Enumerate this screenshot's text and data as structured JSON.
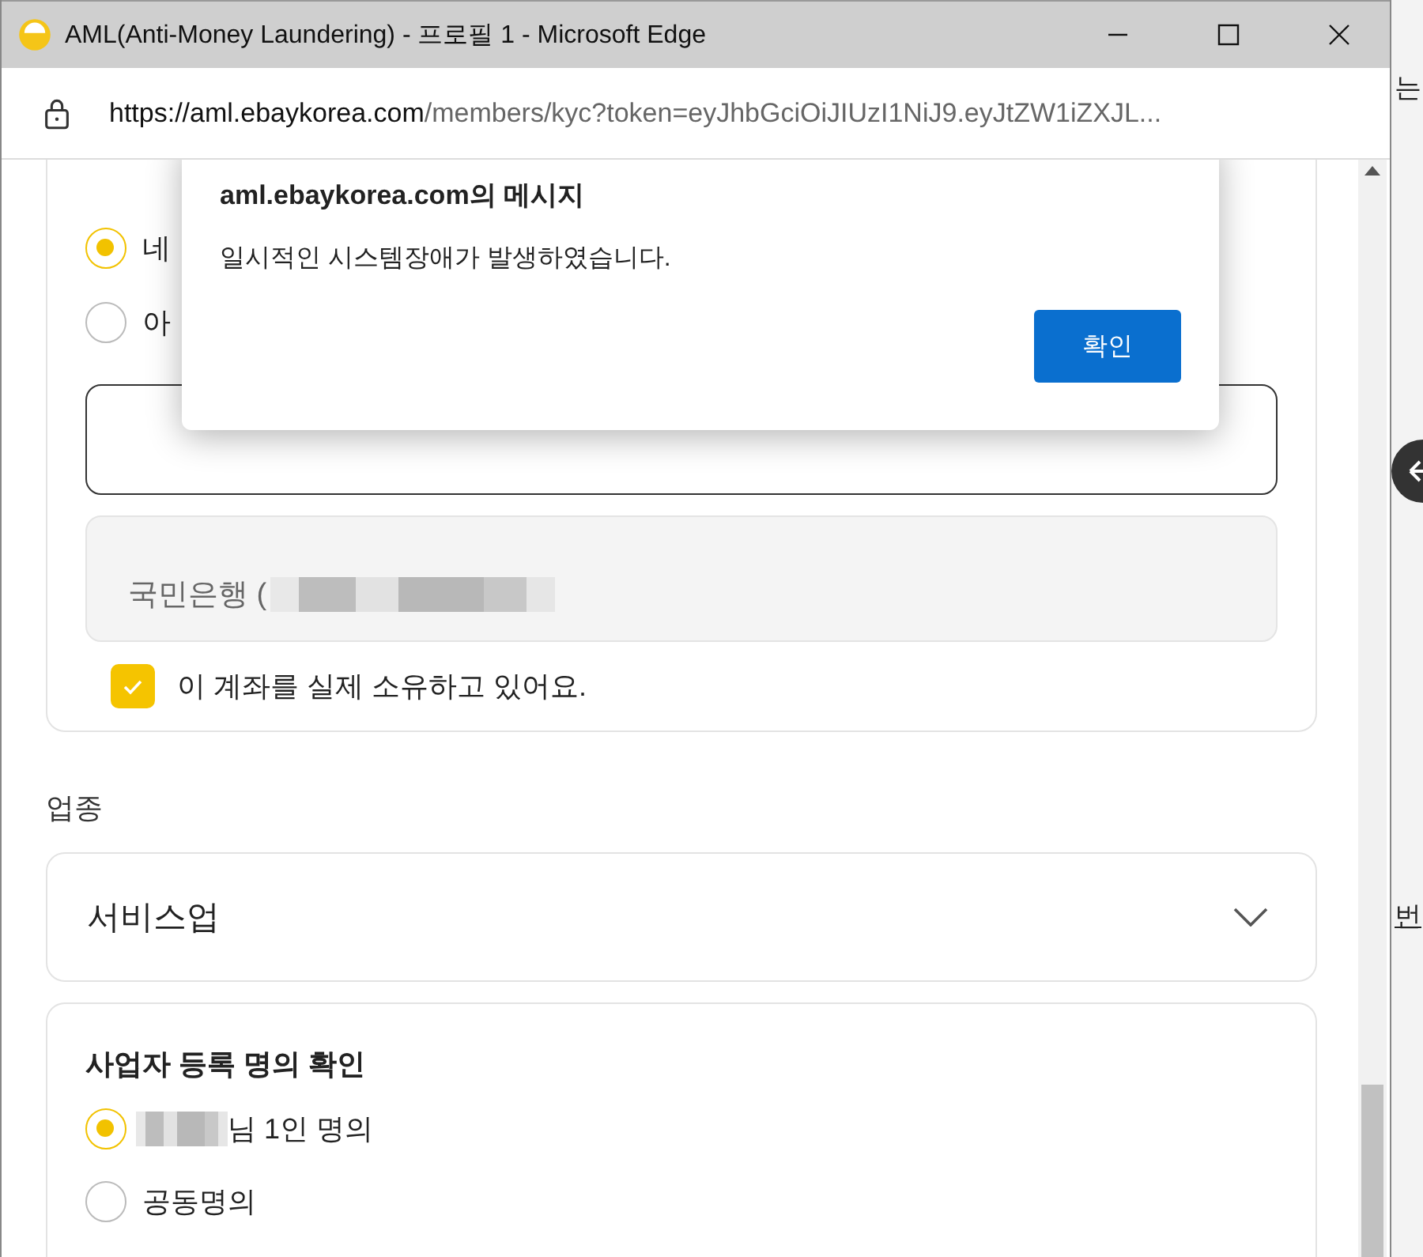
{
  "window": {
    "title": "AML(Anti-Money Laundering) - 프로필 1 - Microsoft Edge"
  },
  "address_bar": {
    "host": "https://aml.ebaykorea.com",
    "path": "/members/kyc?token=eyJhbGciOiJIUzI1NiJ9.eyJtZW1iZXJL..."
  },
  "background_page": {
    "fragments": [
      "는",
      "번"
    ]
  },
  "ownership": {
    "options": [
      {
        "label": "네",
        "selected": true
      },
      {
        "label": "아",
        "selected": false
      }
    ],
    "account_field": {
      "value": "국민은행 ("
    },
    "confirm_checkbox": {
      "label": "이 계좌를 실제 소유하고 있어요.",
      "checked": true
    }
  },
  "industry": {
    "label": "업종",
    "value": "서비스업"
  },
  "registration": {
    "title": "사업자 등록 명의 확인",
    "options": [
      {
        "label": "님 1인 명의",
        "redacted": true,
        "selected": true
      },
      {
        "label": "공동명의",
        "redacted": false,
        "selected": false
      }
    ]
  },
  "dialog": {
    "title": "aml.ebaykorea.com의 메시지",
    "message": "일시적인 시스템장애가 발생하였습니다.",
    "button": "확인"
  }
}
